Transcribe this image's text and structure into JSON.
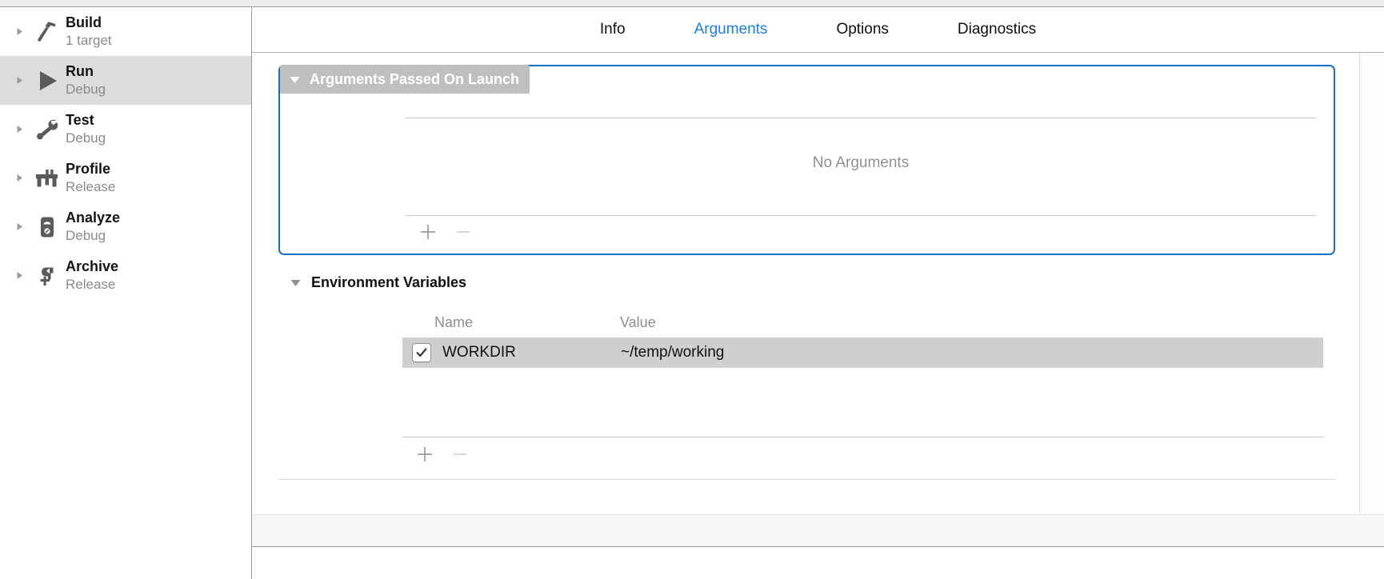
{
  "sidebar": {
    "items": [
      {
        "title": "Build",
        "subtitle": "1 target",
        "icon": "hammer-icon",
        "selected": false
      },
      {
        "title": "Run",
        "subtitle": "Debug",
        "icon": "play-icon",
        "selected": true
      },
      {
        "title": "Test",
        "subtitle": "Debug",
        "icon": "wrench-icon",
        "selected": false
      },
      {
        "title": "Profile",
        "subtitle": "Release",
        "icon": "caliper-icon",
        "selected": false
      },
      {
        "title": "Analyze",
        "subtitle": "Debug",
        "icon": "gauge-icon",
        "selected": false
      },
      {
        "title": "Archive",
        "subtitle": "Release",
        "icon": "archive-icon",
        "selected": false
      }
    ]
  },
  "tabs": [
    {
      "label": "Info",
      "active": false
    },
    {
      "label": "Arguments",
      "active": true
    },
    {
      "label": "Options",
      "active": false
    },
    {
      "label": "Diagnostics",
      "active": false
    }
  ],
  "arguments_section": {
    "header": "Arguments Passed On Launch",
    "disclosure": "expanded",
    "empty_text": "No Arguments",
    "add_label": "+",
    "remove_label": "−"
  },
  "environment_section": {
    "header": "Environment Variables",
    "disclosure": "expanded",
    "columns": [
      "Name",
      "Value"
    ],
    "rows": [
      {
        "checked": true,
        "name": "WORKDIR",
        "value": "~/temp/working",
        "selected": true
      }
    ],
    "add_label": "+",
    "remove_label": "−"
  },
  "colors": {
    "accent_tab": "#1a7ded",
    "focus_ring": "#176fc1",
    "selected_row": "#dcdcdc",
    "selected_table_row": "#cfcfcf",
    "header_highlight": "#bfbfbf",
    "muted_text": "#8a8a8a"
  }
}
